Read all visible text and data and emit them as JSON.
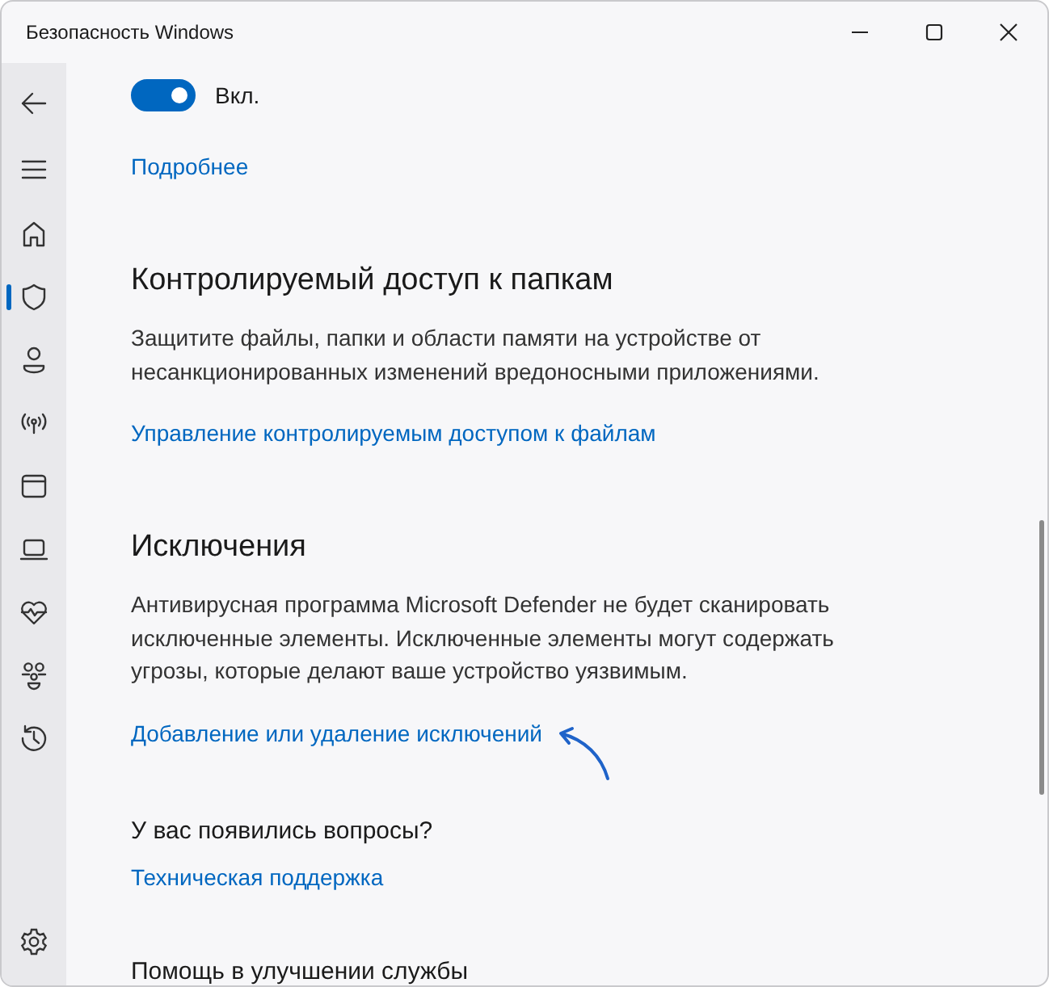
{
  "window": {
    "title": "Безопасность Windows"
  },
  "nav": [
    {
      "kind": "back",
      "selected": false
    },
    {
      "kind": "menu",
      "selected": false
    },
    {
      "kind": "home",
      "selected": false
    },
    {
      "kind": "shield",
      "selected": true
    },
    {
      "kind": "person",
      "selected": false
    },
    {
      "kind": "wireless",
      "selected": false
    },
    {
      "kind": "window",
      "selected": false
    },
    {
      "kind": "laptop",
      "selected": false
    },
    {
      "kind": "heart",
      "selected": false
    },
    {
      "kind": "family",
      "selected": false
    },
    {
      "kind": "history",
      "selected": false
    }
  ],
  "settings_icon": {
    "selected": false
  },
  "toggle": {
    "on": true,
    "label": "Вкл."
  },
  "more_link": "Подробнее",
  "sections": [
    {
      "title": "Контролируемый доступ к папкам",
      "text": "Защитите файлы, папки и области памяти на устройстве от несанкционированных изменений вредоносными приложениями.",
      "link": "Управление контролируемым доступом к файлам",
      "annotated": false
    },
    {
      "title": "Исключения",
      "text": "Антивирусная программа Microsoft Defender не будет сканировать исключенные элементы. Исключенные элементы могут содержать угрозы, которые делают ваше устройство уязвимым.",
      "link": "Добавление или удаление исключений",
      "annotated": true
    }
  ],
  "questions": {
    "title": "У вас появились вопросы?",
    "link": "Техническая поддержка"
  },
  "next_heading": "Помощь в улучшении службы"
}
